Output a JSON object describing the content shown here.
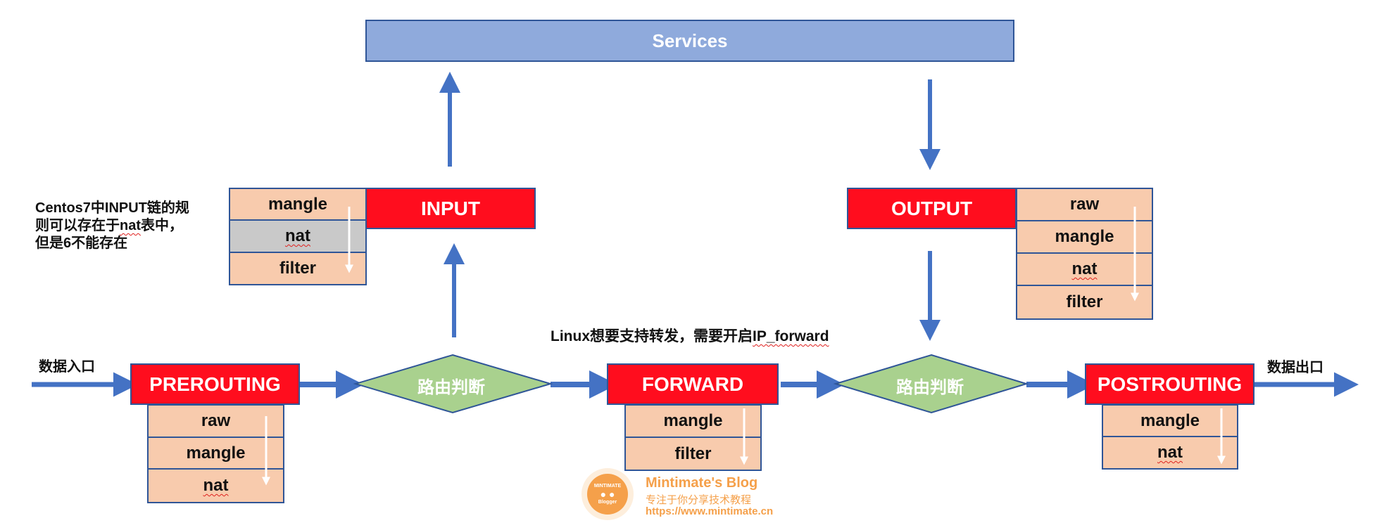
{
  "services": {
    "label": "Services"
  },
  "entry_label": "数据入口",
  "exit_label": "数据出口",
  "note": {
    "lines": [
      "Centos7中INPUT链的规",
      "则可以存在于",
      "nat",
      "表中，",
      "但是6不能存在"
    ]
  },
  "forward_note": {
    "prefix": "Linux想要支持转发，需要开启",
    "highlight": "IP_forward"
  },
  "routing_decision": {
    "label": "路由判断"
  },
  "chains": {
    "prerouting": {
      "label": "PREROUTING",
      "tables": [
        "raw",
        "mangle",
        "nat"
      ]
    },
    "input": {
      "label": "INPUT",
      "tables": [
        "mangle",
        "nat",
        "filter"
      ]
    },
    "forward": {
      "label": "FORWARD",
      "tables": [
        "mangle",
        "filter"
      ]
    },
    "output": {
      "label": "OUTPUT",
      "tables": [
        "raw",
        "mangle",
        "nat",
        "filter"
      ]
    },
    "postrouting": {
      "label": "POSTROUTING",
      "tables": [
        "mangle",
        "nat"
      ]
    }
  },
  "watermark": {
    "title": "Mintimate's Blog",
    "subtitle": "专注于你分享技术教程",
    "url": "https://www.mintimate.cn",
    "logo_top": "MINTIMATE",
    "logo_bottom": "Blogger"
  },
  "colors": {
    "chain_red": "#FF0D1E",
    "table_peach": "#F8CBAD",
    "services_blue": "#8FAADC",
    "border_blue": "#2F5597",
    "arrow_blue": "#4472C4",
    "diamond_green": "#A9D18E",
    "watermark_orange": "#F5A04A"
  }
}
